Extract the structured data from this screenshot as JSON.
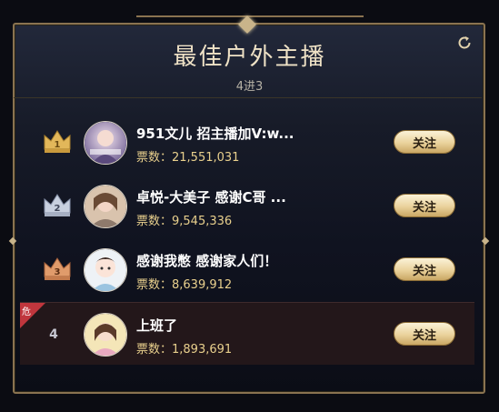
{
  "header": {
    "title": "最佳户外主播",
    "subtitle": "4进3"
  },
  "icons": {
    "refresh": "refresh-icon",
    "crown": "crown-icon",
    "danger": "danger-flag-icon"
  },
  "colors": {
    "gold": "#e9d08d",
    "crown_gold": "#e2b75a",
    "crown_silver": "#c8d0df",
    "crown_bronze": "#e09b6b",
    "danger": "#c0363d"
  },
  "ranking": [
    {
      "rank": "1",
      "name": "951文儿 招主播加V:w...",
      "votes": "票数：21,551,031",
      "follow": "关注"
    },
    {
      "rank": "2",
      "name": "卓悦-大美子 感谢C哥 ...",
      "votes": "票数：9,545,336",
      "follow": "关注"
    },
    {
      "rank": "3",
      "name": "感谢我憋 感谢家人们！",
      "votes": "票数：8,639,912",
      "follow": "关注"
    },
    {
      "rank": "4",
      "name": "上班了",
      "votes": "票数：1,893,691",
      "follow": "关注",
      "danger": "危"
    }
  ]
}
